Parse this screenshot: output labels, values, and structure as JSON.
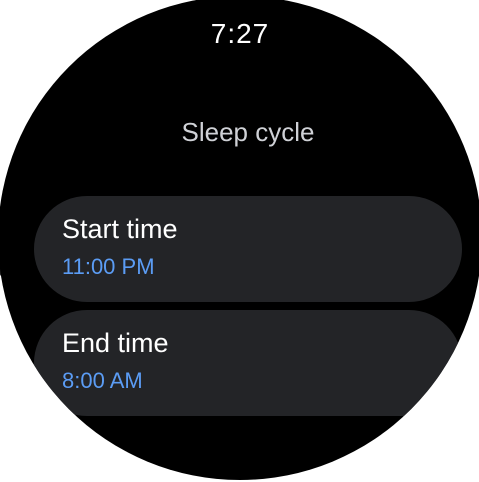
{
  "status": {
    "time": "7:27"
  },
  "screen": {
    "title": "Sleep cycle"
  },
  "settings": [
    {
      "label": "Start time",
      "value": "11:00 PM"
    },
    {
      "label": "End time",
      "value": "8:00 AM"
    }
  ],
  "colors": {
    "background": "#000000",
    "chip": "#232427",
    "accent": "#5b9cf4",
    "text": "#ffffff"
  }
}
